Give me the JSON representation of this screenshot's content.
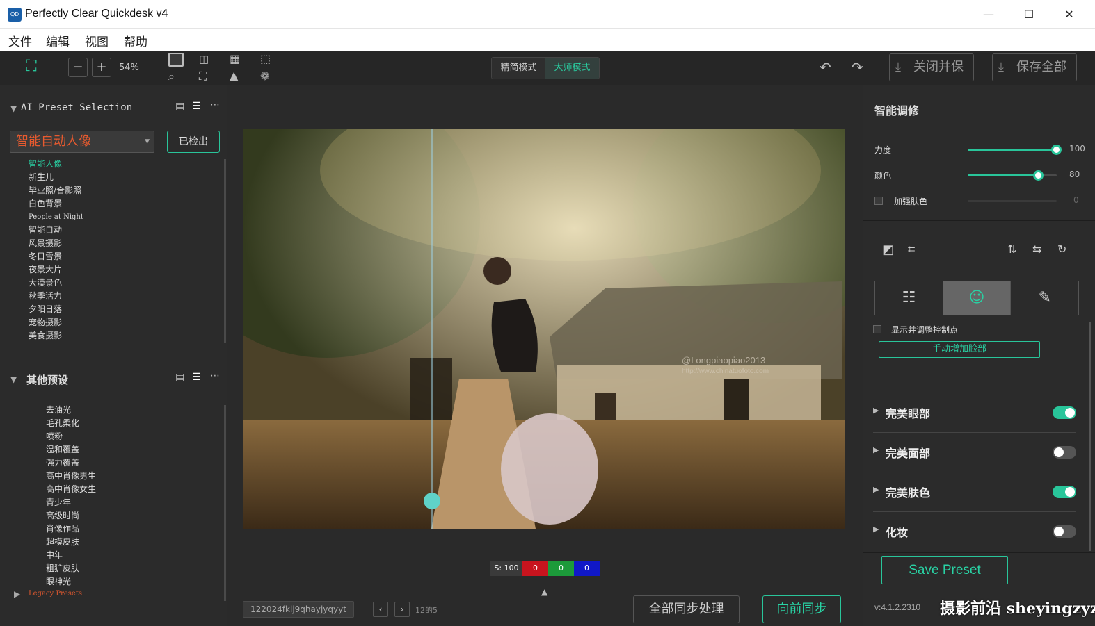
{
  "window": {
    "title": "Perfectly Clear Quickdesk v4",
    "app_icon_text": "QD"
  },
  "menu": {
    "items": [
      "文件",
      "编辑",
      "视图",
      "帮助"
    ]
  },
  "toolbar": {
    "zoom": "54%",
    "mode_simple": "精简模式",
    "mode_master": "大师模式",
    "close_and_save": "关闭并保",
    "save_all": "保存全部"
  },
  "left": {
    "ai_section_title": "AI Preset Selection",
    "preset_select_value": "智能自动人像",
    "detected_button": "已检出",
    "ai_presets": [
      "智能人像",
      "新生儿",
      "毕业照/合影照",
      "白色背景",
      "People at Night",
      "智能自动",
      "风景摄影",
      "冬日雪景",
      "夜景大片",
      "大漠景色",
      "秋季活力",
      "夕阳日落",
      "宠物摄影",
      "美食摄影"
    ],
    "other_section_title": "其他预设",
    "other_presets": [
      "去油光",
      "毛孔柔化",
      "喷粉",
      "温和覆盖",
      "强力覆盖",
      "高中肖像男生",
      "高中肖像女生",
      "青少年",
      "高级时尚",
      "肖像作品",
      "超模皮肤",
      "中年",
      "粗犷皮肤",
      "眼神光"
    ],
    "legacy_presets": "Legacy Presets"
  },
  "canvas": {
    "photo_watermark": "@Longpiaopiao2013",
    "photo_watermark_url": "http://www.chinatuofoto.com",
    "readout_s": "S: 100",
    "readout_r": "0",
    "readout_g": "0",
    "readout_b": "0",
    "readout_colors": {
      "r": "#c8141e",
      "g": "#1c9a3a",
      "b": "#1018c8"
    },
    "filename": "122024fklj9qhayjyqyyt",
    "page_count": "12的5",
    "sync_all": "全部同步处理",
    "sync_forward": "向前同步"
  },
  "right": {
    "panel_title": "智能调修",
    "strength_label": "力度",
    "strength_value": "100",
    "strength_pct": 100,
    "color_label": "颜色",
    "color_value": "80",
    "color_pct": 80,
    "enhance_skin_label": "加强肤色",
    "enhance_skin_value": "0",
    "show_points_label": "显示并调整控制点",
    "manual_add_face": "手动增加脸部",
    "features": [
      {
        "name": "完美眼部",
        "on": true
      },
      {
        "name": "完美面部",
        "on": false
      },
      {
        "name": "完美肤色",
        "on": true
      },
      {
        "name": "化妆",
        "on": false
      }
    ],
    "save_preset": "Save Preset",
    "version": "v:4.1.2.2310"
  },
  "watermark": "摄影前沿 sheyingzyz.com",
  "colors": {
    "accent": "#29c59a",
    "orange": "#e65a2f"
  }
}
